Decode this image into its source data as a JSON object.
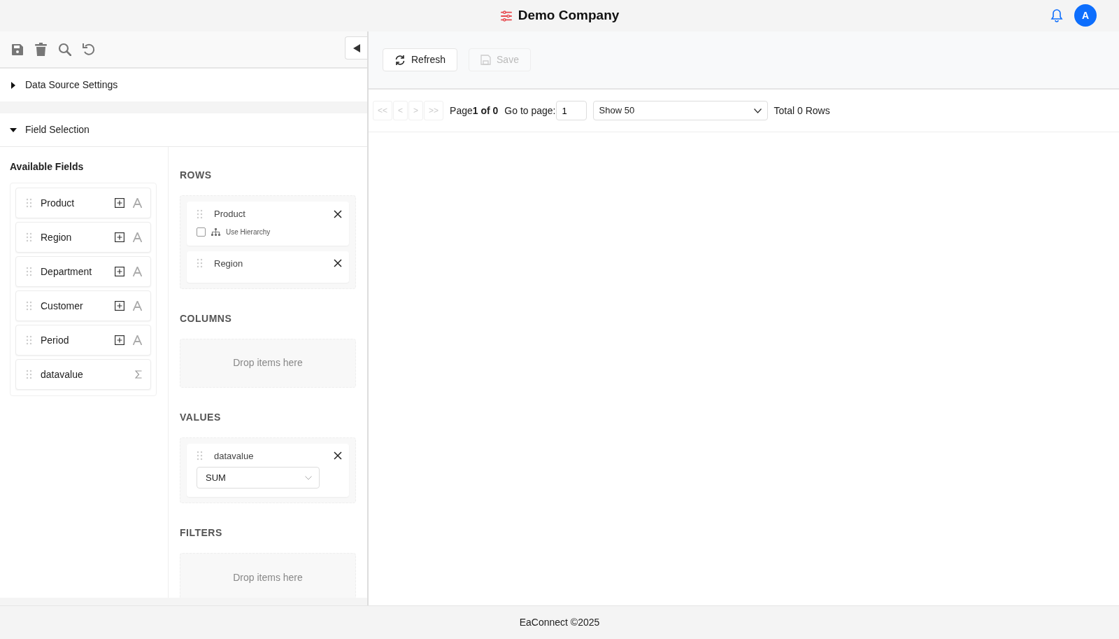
{
  "header": {
    "title": "Demo Company",
    "avatar": "A"
  },
  "sections": [
    {
      "title": "Data Source Settings",
      "expanded": false
    },
    {
      "title": "Field Selection",
      "expanded": true
    }
  ],
  "available_fields": {
    "title": "Available Fields",
    "fields": [
      {
        "name": "Product",
        "kind": "dimension"
      },
      {
        "name": "Region",
        "kind": "dimension"
      },
      {
        "name": "Department",
        "kind": "dimension"
      },
      {
        "name": "Customer",
        "kind": "dimension"
      },
      {
        "name": "Period",
        "kind": "dimension"
      },
      {
        "name": "datavalue",
        "kind": "measure"
      }
    ]
  },
  "zones": [
    {
      "title": "ROWS",
      "items": [
        {
          "name": "Product",
          "hierarchy": {
            "label": "Use Hierarchy",
            "checked": false
          }
        },
        {
          "name": "Region"
        }
      ]
    },
    {
      "title": "COLUMNS",
      "empty_text": "Drop items here"
    },
    {
      "title": "VALUES",
      "items": [
        {
          "name": "datavalue",
          "aggregation": "SUM"
        }
      ]
    },
    {
      "title": "FILTERS",
      "empty_text": "Drop items here"
    }
  ],
  "toolbar_buttons": [
    {
      "label": "Refresh",
      "kind": "refresh",
      "disabled": false
    },
    {
      "label": "Save",
      "kind": "save",
      "disabled": true
    }
  ],
  "pager": {
    "nav": [
      {
        "label": "<<",
        "disabled": true
      },
      {
        "label": "<",
        "disabled": true
      },
      {
        "label": ">",
        "disabled": true
      },
      {
        "label": ">>",
        "disabled": true
      }
    ],
    "page_label": "Page",
    "page_info": "1 of 0",
    "goto_label": "Go to page:",
    "goto_value": "1",
    "page_size": "Show 50",
    "total": "Total 0 Rows"
  },
  "footer": "EaConnect ©2025"
}
